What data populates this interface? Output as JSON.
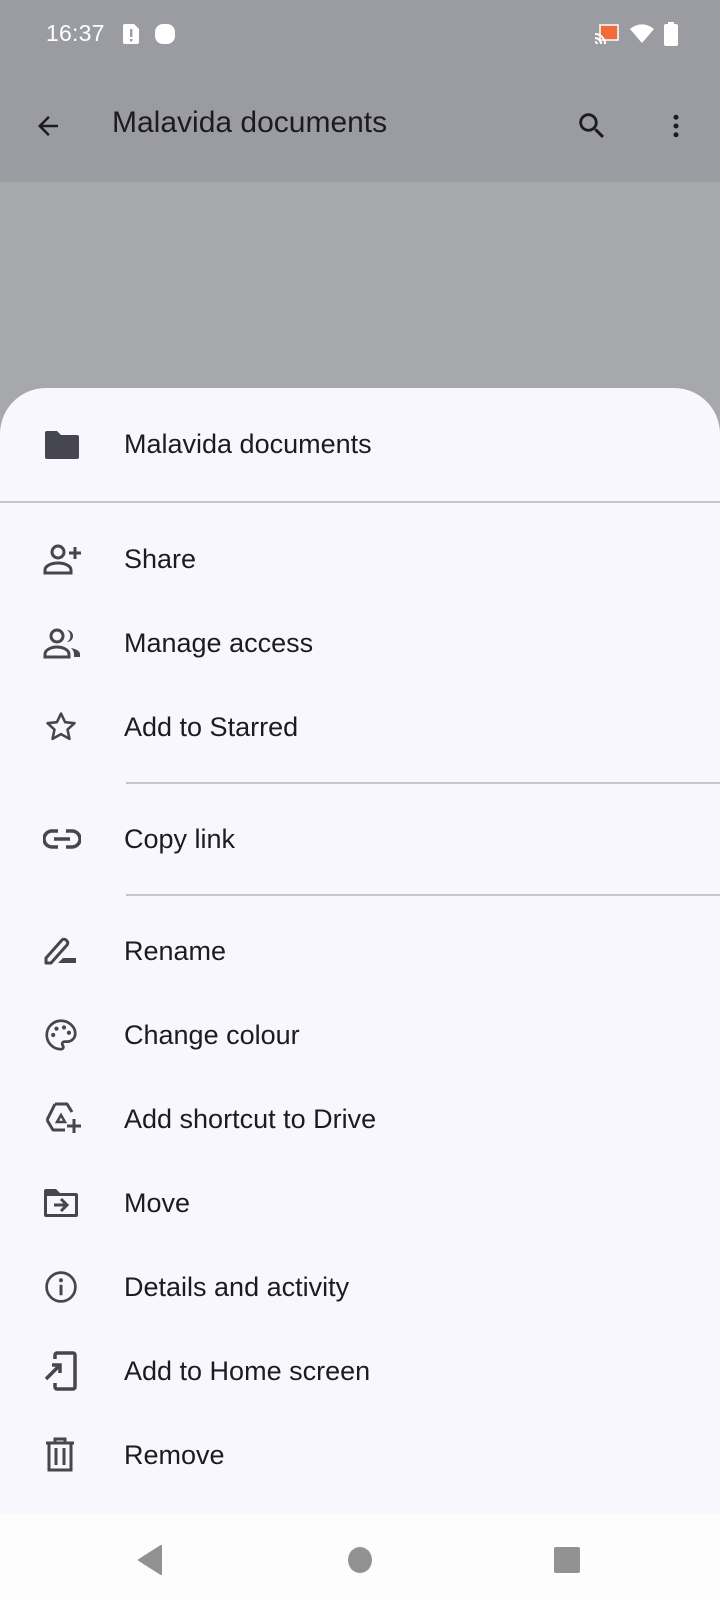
{
  "status_bar": {
    "time": "16:37",
    "left_icons": [
      "sim-alert-icon",
      "notification-dot-icon"
    ],
    "right_icons": [
      "cast-icon",
      "wifi-icon",
      "battery-icon"
    ],
    "cast_accent": "#f26b3a"
  },
  "app_bar": {
    "title": "Malavida documents",
    "back_icon": "arrow-back-icon",
    "actions": [
      "search-icon",
      "more-vert-icon"
    ]
  },
  "sheet": {
    "header": {
      "icon": "folder-icon",
      "title": "Malavida documents"
    },
    "groups": [
      [
        {
          "icon": "person-add-icon",
          "label": "Share"
        },
        {
          "icon": "people-icon",
          "label": "Manage access"
        },
        {
          "icon": "star-outline-icon",
          "label": "Add to Starred"
        }
      ],
      [
        {
          "icon": "link-icon",
          "label": "Copy link"
        }
      ],
      [
        {
          "icon": "rename-icon",
          "label": "Rename"
        },
        {
          "icon": "palette-icon",
          "label": "Change colour"
        },
        {
          "icon": "add-to-drive-icon",
          "label": "Add shortcut to Drive"
        },
        {
          "icon": "move-folder-icon",
          "label": "Move"
        },
        {
          "icon": "info-icon",
          "label": "Details and activity"
        },
        {
          "icon": "add-to-home-icon",
          "label": "Add to Home screen"
        },
        {
          "icon": "trash-icon",
          "label": "Remove"
        }
      ]
    ]
  },
  "nav_bar": {
    "buttons": [
      "nav-back-icon",
      "nav-home-icon",
      "nav-recents-icon"
    ]
  },
  "colors": {
    "scrim": "#a7a8ac",
    "sheet_bg": "#f8f7fd",
    "icon": "#45464f",
    "text": "#1c1b20",
    "nav_icon": "#929292"
  }
}
